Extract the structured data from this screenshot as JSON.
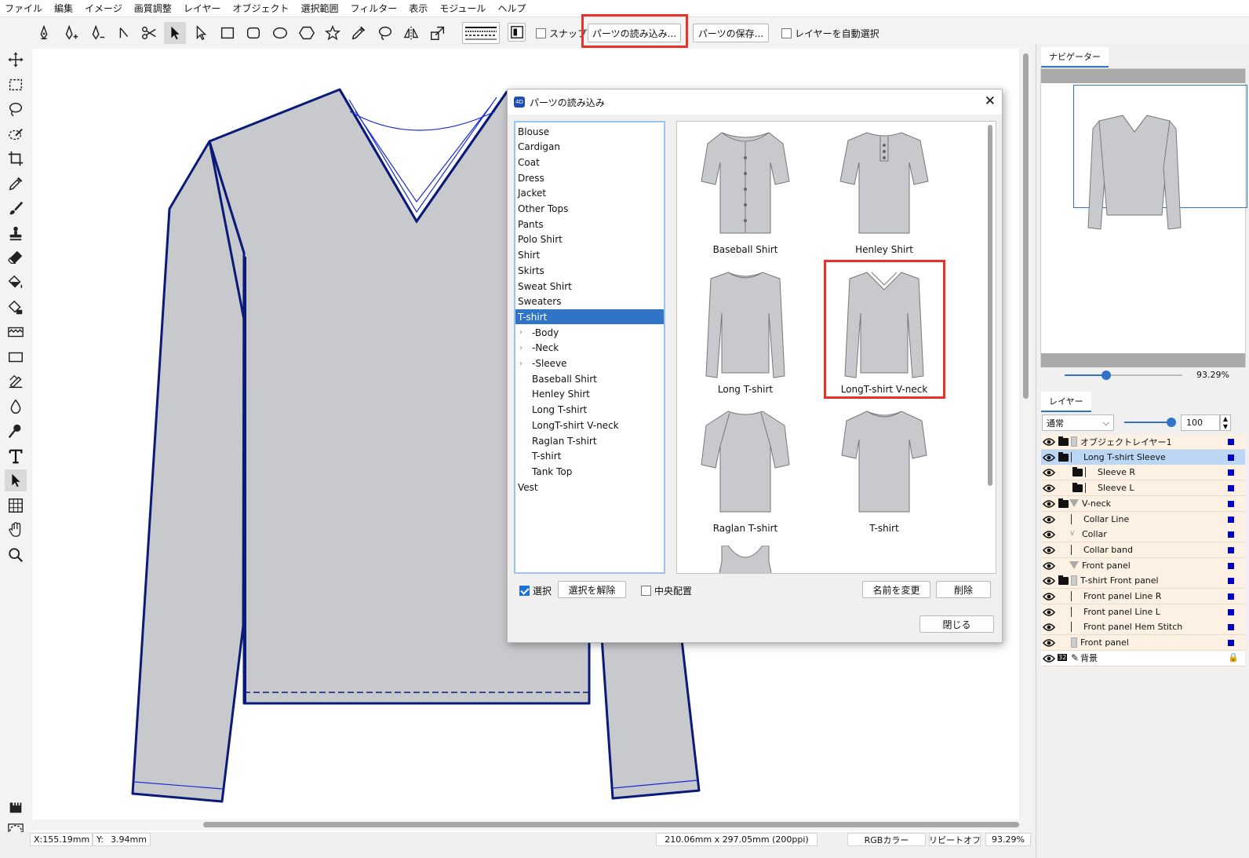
{
  "menu": [
    "ファイル",
    "編集",
    "イメージ",
    "画質調整",
    "レイヤー",
    "オブジェクト",
    "選択範囲",
    "フィルター",
    "表示",
    "モジュール",
    "ヘルプ"
  ],
  "toolbar": {
    "snap_label": "スナップ",
    "load_parts_label": "パーツの読み込み...",
    "save_parts_label": "パーツの保存...",
    "auto_select_label": "レイヤーを自動選択"
  },
  "dialog": {
    "title": "パーツの読み込み",
    "categories": [
      "Blouse",
      "Cardigan",
      "Coat",
      "Dress",
      "Jacket",
      "Other Tops",
      "Pants",
      "Polo Shirt",
      "Shirt",
      "Skirts",
      "Sweat Shirt",
      "Sweaters",
      "T-shirt"
    ],
    "selected_category": "T-shirt",
    "subgroups": [
      "-Body",
      "-Neck",
      "-Sleeve"
    ],
    "subitems": [
      "Baseball Shirt",
      "Henley Shirt",
      "Long T-shirt",
      "LongT-shirt V-neck",
      "Raglan T-shirt",
      "T-shirt",
      "Tank Top"
    ],
    "after": [
      "Vest"
    ],
    "thumbs": [
      "Baseball Shirt",
      "Henley Shirt",
      "Long T-shirt",
      "LongT-shirt V-neck",
      "Raglan T-shirt",
      "T-shirt"
    ],
    "select_label": "選択",
    "deselect_label": "選択を解除",
    "center_label": "中央配置",
    "rename_label": "名前を変更",
    "delete_label": "削除",
    "close_label": "閉じる"
  },
  "navigator": {
    "tab": "ナビゲーター",
    "zoom": "93.29%"
  },
  "layers": {
    "tab": "レイヤー",
    "blend": "通常",
    "opacity": "100",
    "items": [
      "オブジェクトレイヤー1",
      "Long T-shirt Sleeve",
      "Sleeve R",
      "Sleeve L",
      "V-neck",
      "Collar Line",
      "Collar",
      "Collar band",
      "Front panel",
      "T-shirt Front panel",
      "Front panel Line R",
      "Front panel Line L",
      "Front panel Hem Stitch",
      "Front panel"
    ],
    "background": "背景",
    "background_badge": "32"
  },
  "status": {
    "x_label": "X:",
    "x_value": "155.19mm",
    "y_label": "Y:",
    "y_value": "3.94mm",
    "size": "210.06mm x 297.05mm (200ppi)",
    "color_mode": "RGBカラー",
    "repeat": "リピートオフ",
    "zoom": "93.29%"
  },
  "colors": {
    "highlight": "#e8322a",
    "accent": "#2f74c6",
    "garment": "#c8c9cc",
    "outline": "#0a1a78",
    "layer_swatch": "#0000c8"
  }
}
